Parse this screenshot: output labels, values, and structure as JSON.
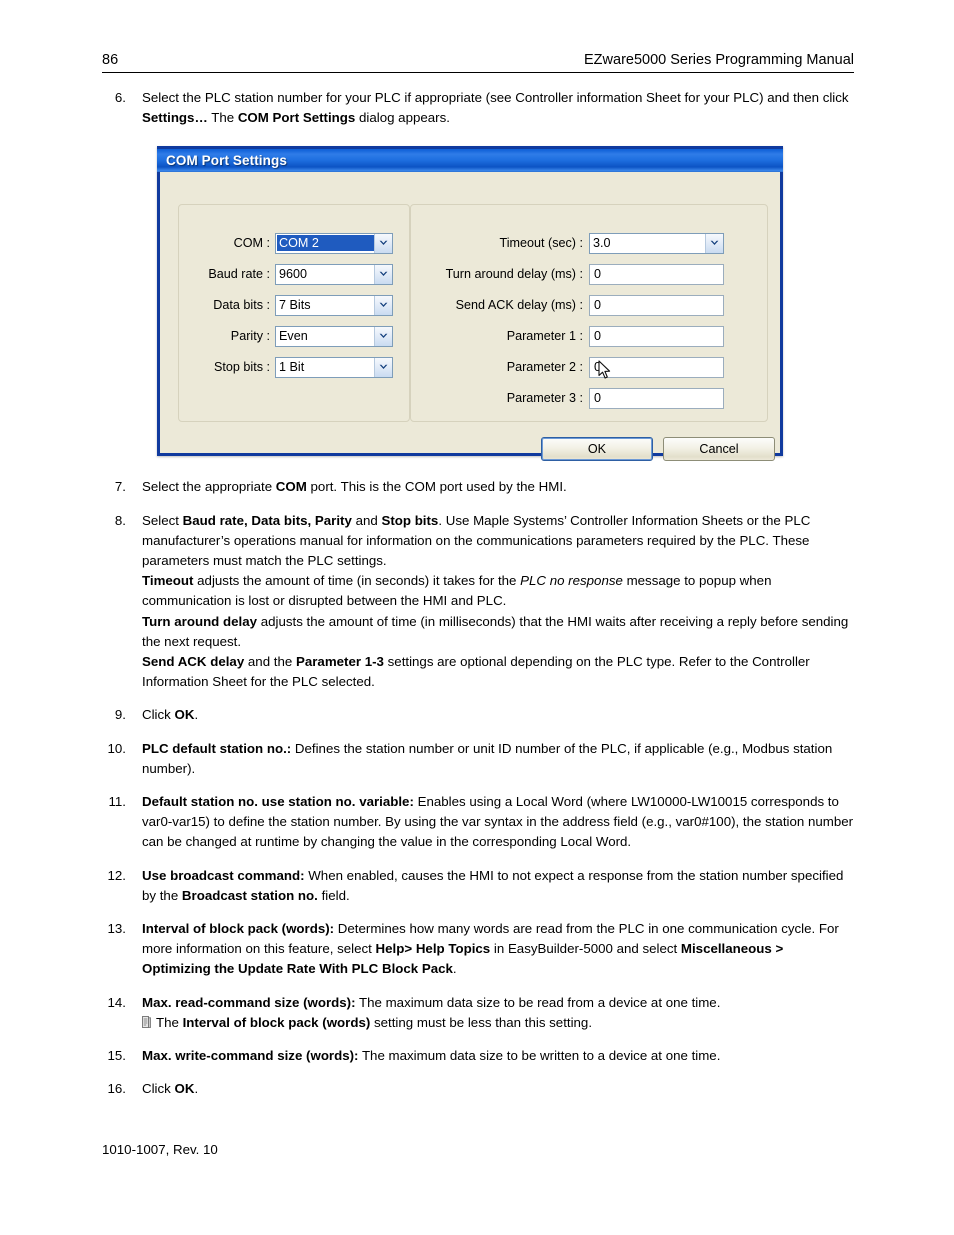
{
  "header": {
    "page_number": "86",
    "manual_title": "EZware5000 Series Programming Manual"
  },
  "footer": {
    "doc_id": "1010-1007, Rev. 10"
  },
  "steps": [
    {
      "number": "6.",
      "html": "Select the PLC station number for your PLC if appropriate (see Controller information Sheet for your PLC) and then click <b>Settings&hellip;</b> The <b>COM Port Settings</b> dialog appears."
    },
    {
      "number": "7.",
      "html": "Select the appropriate <b>COM</b> port. This is the COM port used by the HMI."
    },
    {
      "number": "8.",
      "html": "Select <b>Baud rate, Data bits, Parity</b> and <b>Stop bits</b>. Use Maple Systems&rsquo; Controller Information Sheets or the PLC manufacturer&rsquo;s operations manual for information on the communications parameters required by the PLC. These parameters must match the PLC settings.<br><b>Timeout</b> adjusts the amount of time (in seconds) it takes for the <i>PLC no response</i> message to popup when communication is lost or disrupted between the HMI and PLC.<br><b>Turn around delay</b> adjusts the amount of time (in milliseconds) that the HMI waits after receiving a reply before sending the next request.<br><b>Send ACK delay</b> and the <b>Parameter 1-3</b> settings are optional depending on the PLC type. Refer to the Controller Information Sheet for the PLC selected."
    },
    {
      "number": "9.",
      "html": "Click <b>OK</b>."
    },
    {
      "number": "10.",
      "html": "<b>PLC default station no.:</b> Defines the station number or unit ID number of the PLC, if applicable (e.g., Modbus station number)."
    },
    {
      "number": "11.",
      "html": "<b>Default station no. use station no. variable:</b> Enables using a Local Word (where LW10000-LW10015 corresponds to var0-var15) to define the station number. By using the var syntax in the address field (e.g., var0#100), the station number can be changed at runtime by changing the value in the corresponding Local Word."
    },
    {
      "number": "12.",
      "html": "<b>Use broadcast command:</b> When enabled, causes the HMI to not expect a response from the station number specified by the <b>Broadcast station no.</b> field."
    },
    {
      "number": "13.",
      "html": "<b>Interval of block pack (words):</b> Determines how many words are read from the PLC in one communication cycle. For more information on this feature, select <b>Help&gt; Help Topics</b> in EasyBuilder-5000 and select <b>Miscellaneous &gt; Optimizing the Update Rate With PLC Block Pack</b>."
    },
    {
      "number": "14.",
      "html": "<b>Max. read-command size (words):</b> The maximum data size to be read from a device at one time.<span class=\"sub-note\"><span class=\"note-icon-slot\"></span>The <b>Interval of block pack (words)</b> setting must be less than this setting.</span>"
    },
    {
      "number": "15.",
      "html": "<b>Max. write-command size (words):</b> The maximum data size to be written to a device at one time."
    },
    {
      "number": "16.",
      "html": "Click <b>OK</b>."
    }
  ],
  "dialog": {
    "title": "COM Port Settings",
    "left_fields": [
      {
        "label": "COM :",
        "value": "COM 2",
        "control": "combo",
        "focused": true
      },
      {
        "label": "Baud rate :",
        "value": "9600",
        "control": "combo",
        "focused": false
      },
      {
        "label": "Data bits :",
        "value": "7 Bits",
        "control": "combo",
        "focused": false
      },
      {
        "label": "Parity :",
        "value": "Even",
        "control": "combo",
        "focused": false
      },
      {
        "label": "Stop bits :",
        "value": "1 Bit",
        "control": "combo",
        "focused": false
      }
    ],
    "right_fields": [
      {
        "label": "Timeout (sec) :",
        "value": "3.0",
        "control": "combo"
      },
      {
        "label": "Turn around delay (ms) :",
        "value": "0",
        "control": "text"
      },
      {
        "label": "Send ACK delay (ms) :",
        "value": "0",
        "control": "text"
      },
      {
        "label": "Parameter 1 :",
        "value": "0",
        "control": "text"
      },
      {
        "label": "Parameter 2 :",
        "value": "0",
        "control": "text"
      },
      {
        "label": "Parameter 3 :",
        "value": "0",
        "control": "text"
      }
    ],
    "buttons": {
      "ok": "OK",
      "cancel": "Cancel"
    },
    "colors": {
      "titlebar_blue": "#1868dc",
      "dialog_face": "#ece9d8",
      "selection_blue": "#1f5bbf",
      "border_blue": "#103a9e"
    }
  }
}
